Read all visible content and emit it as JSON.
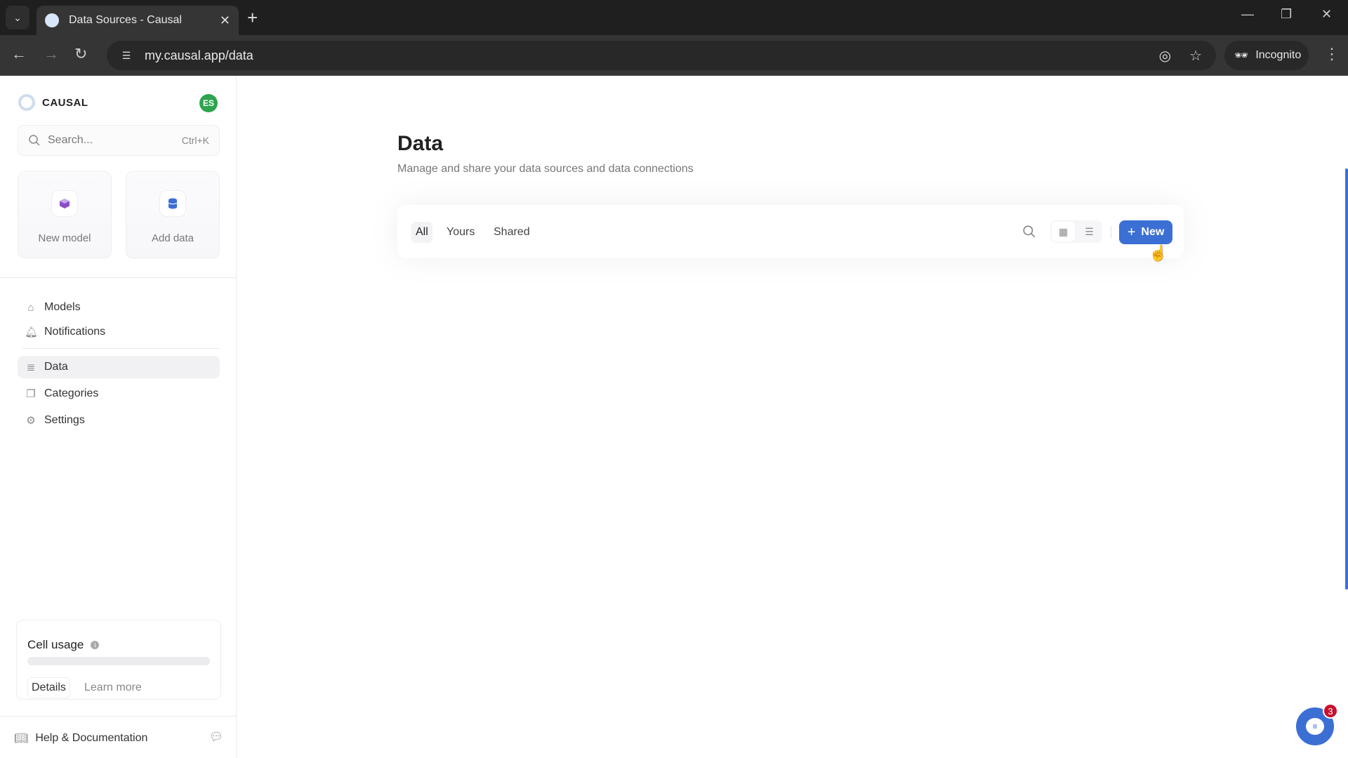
{
  "browser": {
    "tab_title": "Data Sources - Causal",
    "url": "my.causal.app/data",
    "incognito_label": "Incognito"
  },
  "sidebar": {
    "brand": "CAUSAL",
    "avatar_initials": "ES",
    "search": {
      "placeholder": "Search...",
      "shortcut": "Ctrl+K"
    },
    "quick_actions": [
      {
        "label": "New model",
        "icon": "cube-icon",
        "color": "#8b4fc7"
      },
      {
        "label": "Add data",
        "icon": "database-icon",
        "color": "#3b6fd4"
      }
    ],
    "nav_primary": [
      {
        "label": "Models",
        "icon": "home-icon"
      },
      {
        "label": "Notifications",
        "icon": "bell-icon"
      }
    ],
    "nav_secondary": [
      {
        "label": "Data",
        "icon": "database-icon",
        "active": true
      },
      {
        "label": "Categories",
        "icon": "copy-icon"
      },
      {
        "label": "Settings",
        "icon": "gear-icon"
      }
    ],
    "cell_usage": {
      "title": "Cell usage",
      "progress_percent": 0,
      "details_label": "Details",
      "learn_more_label": "Learn more"
    },
    "help_label": "Help & Documentation"
  },
  "main": {
    "title": "Data",
    "subtitle": "Manage and share your data sources and data connections",
    "filter_tabs": [
      {
        "label": "All",
        "active": true
      },
      {
        "label": "Yours"
      },
      {
        "label": "Shared"
      }
    ],
    "new_button_label": "New"
  },
  "chat_widget": {
    "unread_count": "3"
  },
  "colors": {
    "accent": "#3b6fd4",
    "avatar": "#2ea44f",
    "badge": "#c8102e"
  }
}
